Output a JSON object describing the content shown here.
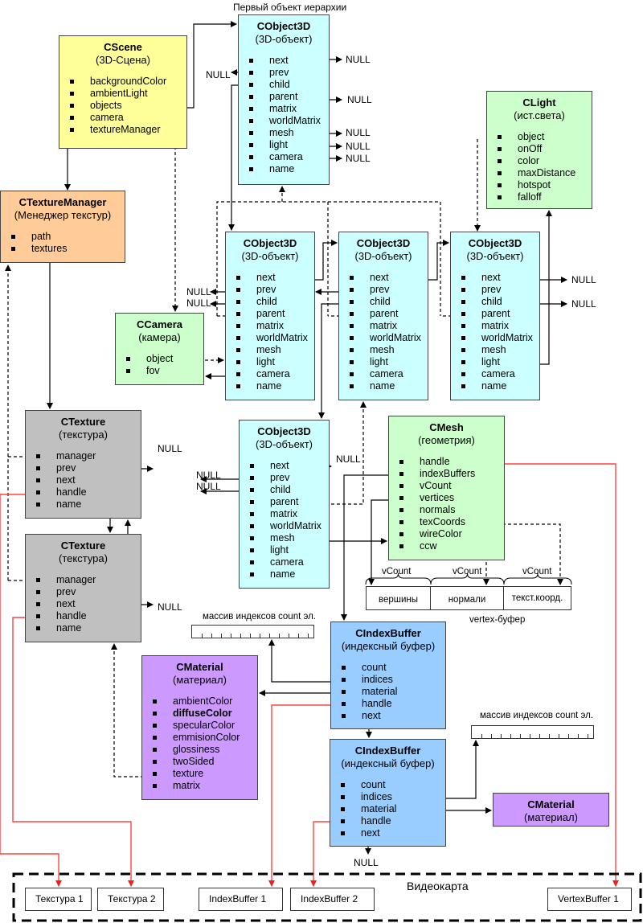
{
  "title": "Первый объект иерархии",
  "colors": {
    "scene": "#ffff99",
    "object": "#ccffff",
    "light": "#ccffcc",
    "texman": "#ffcc99",
    "texture": "#c0c0c0",
    "material": "#cc99ff",
    "indexbuf": "#99ccff",
    "handle_line": "#ff4444"
  },
  "boxes": {
    "scene": {
      "title": "CScene",
      "subtitle": "(3D-Сцена)",
      "fields": [
        "backgroundColor",
        "ambientLight",
        "objects",
        "camera",
        "textureManager"
      ]
    },
    "obj_root": {
      "title": "CObject3D",
      "subtitle": "(3D-объект)",
      "fields": [
        "next",
        "prev",
        "child",
        "parent",
        "matrix",
        "worldMatrix",
        "mesh",
        "light",
        "camera",
        "name"
      ]
    },
    "light": {
      "title": "CLight",
      "subtitle": "(ист.света)",
      "fields": [
        "object",
        "onOff",
        "color",
        "maxDistance",
        "hotspot",
        "falloff"
      ]
    },
    "texman": {
      "title": "CTextureManager",
      "subtitle": "(Менеджер текстур)",
      "fields": [
        "path",
        "textures"
      ]
    },
    "obj_a": {
      "title": "CObject3D",
      "subtitle": "(3D-объект)",
      "fields": [
        "next",
        "prev",
        "child",
        "parent",
        "matrix",
        "worldMatrix",
        "mesh",
        "light",
        "camera",
        "name"
      ]
    },
    "obj_b": {
      "title": "CObject3D",
      "subtitle": "(3D-объект)",
      "fields": [
        "next",
        "prev",
        "child",
        "parent",
        "matrix",
        "worldMatrix",
        "mesh",
        "light",
        "camera",
        "name"
      ]
    },
    "obj_c": {
      "title": "CObject3D",
      "subtitle": "(3D-объект)",
      "fields": [
        "next",
        "prev",
        "child",
        "parent",
        "matrix",
        "worldMatrix",
        "mesh",
        "light",
        "camera",
        "name"
      ]
    },
    "camera": {
      "title": "CCamera",
      "subtitle": "(камера)",
      "fields": [
        "object",
        "fov"
      ]
    },
    "tex1": {
      "title": "CTexture",
      "subtitle": "(текстура)",
      "fields": [
        "manager",
        "prev",
        "next",
        "handle",
        "name"
      ]
    },
    "obj_d": {
      "title": "CObject3D",
      "subtitle": "(3D-объект)",
      "fields": [
        "next",
        "prev",
        "child",
        "parent",
        "matrix",
        "worldMatrix",
        "mesh",
        "light",
        "camera",
        "name"
      ]
    },
    "mesh": {
      "title": "CMesh",
      "subtitle": "(геометрия)",
      "fields": [
        "handle",
        "indexBuffers",
        "vCount",
        "vertices",
        "normals",
        "texCoords",
        "wireColor",
        "ccw"
      ]
    },
    "tex2": {
      "title": "CTexture",
      "subtitle": "(текстура)",
      "fields": [
        "manager",
        "prev",
        "next",
        "handle",
        "name"
      ]
    },
    "ib1": {
      "title": "CIndexBuffer",
      "subtitle": "(индексный буфер)",
      "fields": [
        "count",
        "indices",
        "material",
        "handle",
        "next"
      ]
    },
    "material": {
      "title": "CMaterial",
      "subtitle": "(материал)",
      "fields": [
        "ambientColor",
        "diffuseColor",
        "specularColor",
        "emmisionColor",
        "glossiness",
        "twoSided",
        "texture",
        "matrix"
      ],
      "bold_field": "diffuseColor"
    },
    "ib2": {
      "title": "CIndexBuffer",
      "subtitle": "(индексный буфер)",
      "fields": [
        "count",
        "indices",
        "material",
        "handle",
        "next"
      ]
    },
    "material2": {
      "title": "CMaterial",
      "subtitle": "(материал)",
      "fields": []
    }
  },
  "null_label": "NULL",
  "vertex_buffer": {
    "caption": "vertex-буфер",
    "count_label": "vCount",
    "segments": [
      "вершины",
      "нормали",
      "текст.коорд."
    ]
  },
  "index_array_label": "массив индексов count эл.",
  "gpu": {
    "title": "Видеокарта",
    "items": [
      "Текстура 1",
      "Текстура 2",
      "IndexBuffer 1",
      "IndexBuffer 2",
      "VertexBuffer 1"
    ]
  }
}
